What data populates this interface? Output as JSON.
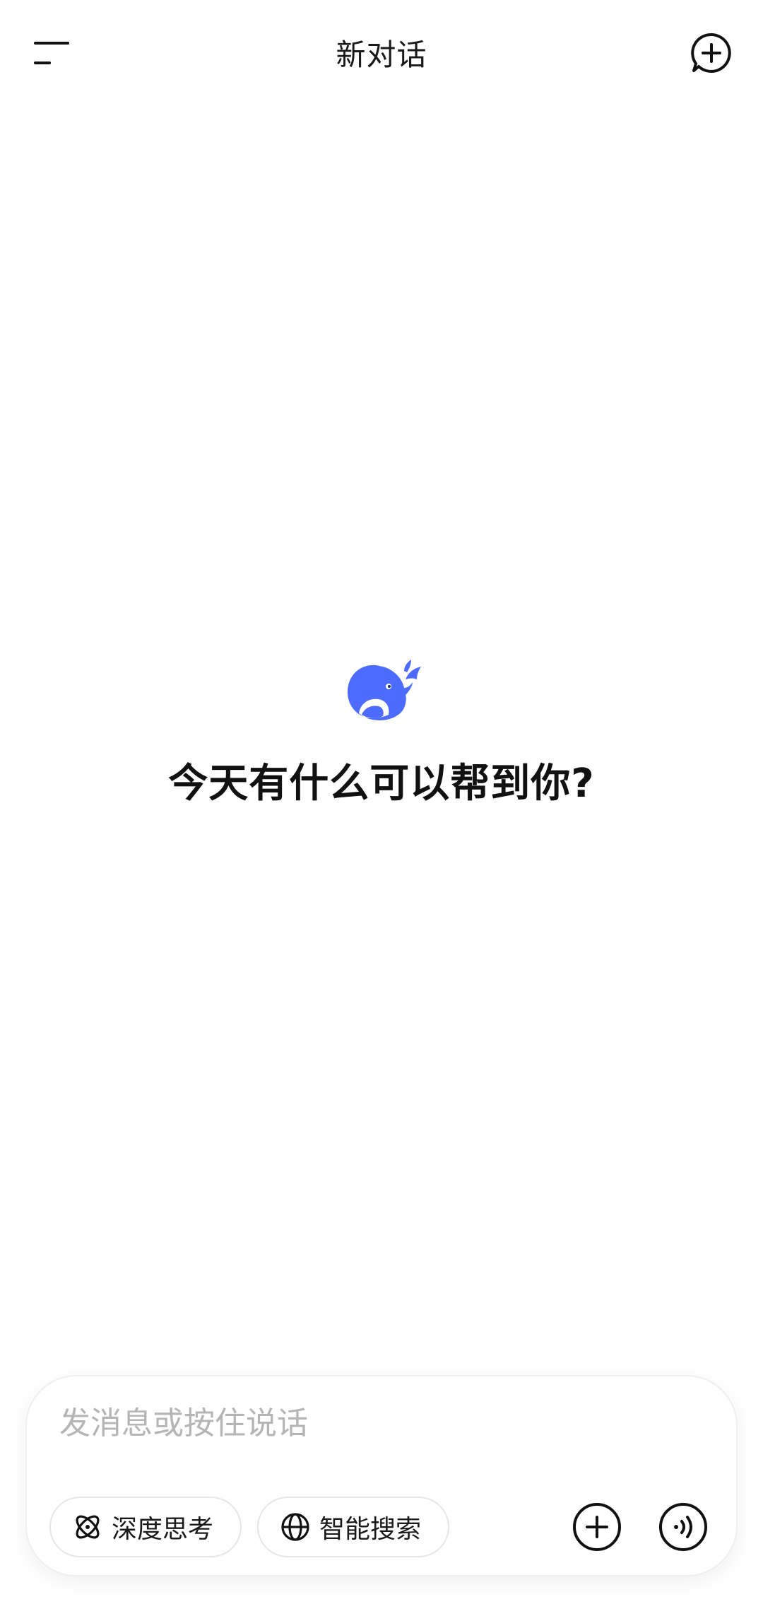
{
  "header": {
    "title": "新对话",
    "menu_icon": "menu-icon",
    "new_chat_icon": "new-chat-icon"
  },
  "welcome": {
    "logo": "whale-logo",
    "message": "今天有什么可以帮到你?"
  },
  "composer": {
    "placeholder": "发消息或按住说话",
    "value": "",
    "chips": [
      {
        "label": "深度思考",
        "icon": "atom-icon"
      },
      {
        "label": "智能搜索",
        "icon": "globe-icon"
      }
    ],
    "attach_icon": "plus-circle-icon",
    "voice_icon": "voice-wave-icon"
  },
  "colors": {
    "brand": "#4D6BFE",
    "text": "#1a1a1a",
    "placeholder": "#b5b5b5",
    "background": "#ffffff"
  }
}
